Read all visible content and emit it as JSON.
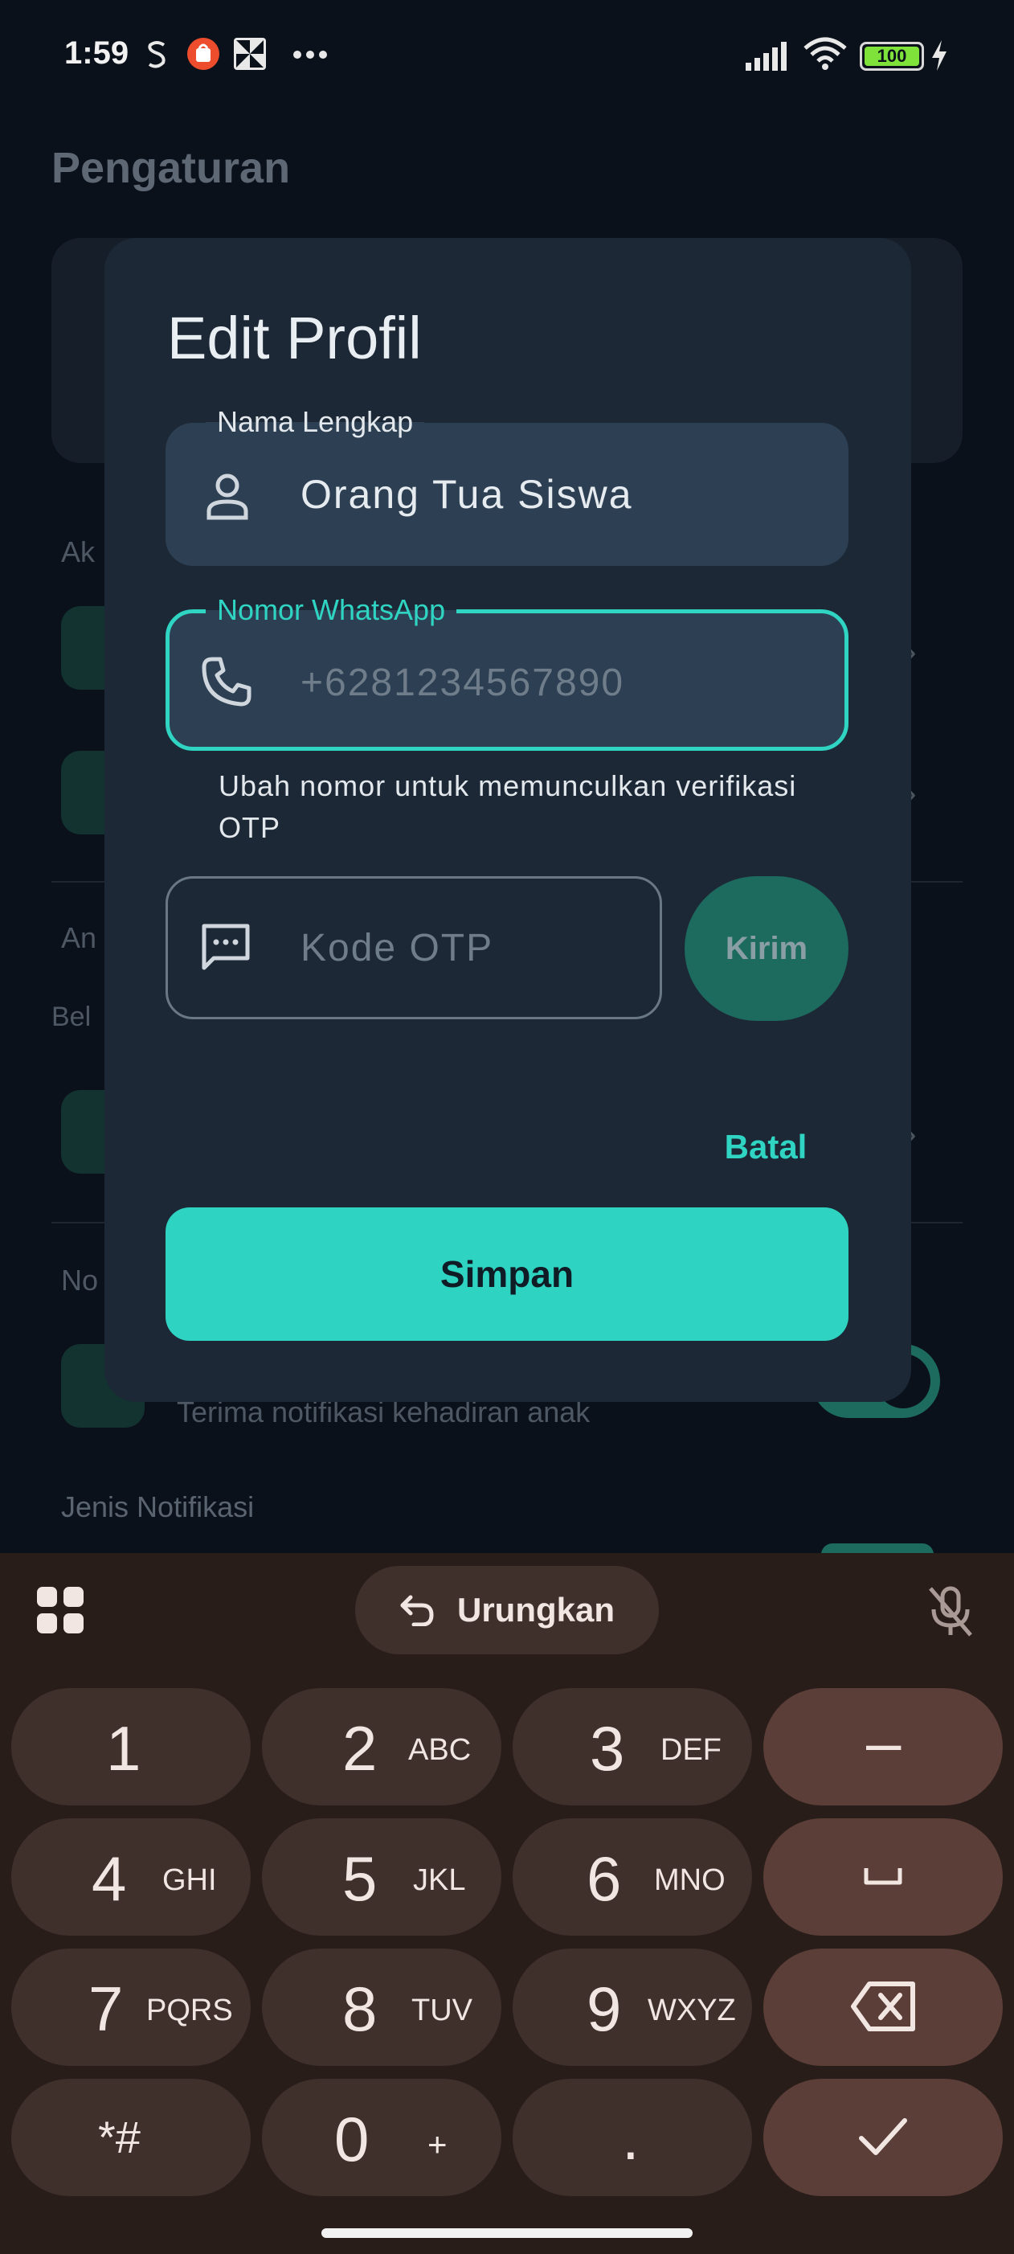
{
  "status_bar": {
    "time": "1:59",
    "notif_icons": [
      "s-shaped-icon",
      "shopee-icon",
      "pinwheel-icon",
      "more-dots-icon"
    ],
    "battery": "100",
    "signal_icon": "signal-bars-icon",
    "wifi_icon": "wifi-icon",
    "charging_icon": "bolt-icon"
  },
  "background_page": {
    "title": "Pengaturan",
    "section_labels": [
      "Ak",
      "An",
      "Bel",
      "No"
    ],
    "notification_subtitle": "Terima notifikasi kehadiran anak",
    "notification_types_label": "Jenis Notifikasi"
  },
  "dialog": {
    "title": "Edit Profil",
    "name_field": {
      "label": "Nama Lengkap",
      "value": "Orang Tua Siswa",
      "icon": "person-icon"
    },
    "phone_field": {
      "label": "Nomor WhatsApp",
      "placeholder": "+6281234567890",
      "icon": "phone-icon",
      "helper": "Ubah nomor untuk memunculkan verifikasi OTP"
    },
    "otp_field": {
      "placeholder": "Kode OTP",
      "icon": "message-icon"
    },
    "send_button": "Kirim",
    "cancel_button": "Batal",
    "save_button": "Simpan"
  },
  "keyboard": {
    "undo_label": "Urungkan",
    "keys": [
      {
        "digit": "1",
        "letters": ""
      },
      {
        "digit": "2",
        "letters": "ABC"
      },
      {
        "digit": "3",
        "letters": "DEF"
      },
      {
        "digit": "4",
        "letters": "GHI"
      },
      {
        "digit": "5",
        "letters": "JKL"
      },
      {
        "digit": "6",
        "letters": "MNO"
      },
      {
        "digit": "7",
        "letters": "PQRS"
      },
      {
        "digit": "8",
        "letters": "TUV"
      },
      {
        "digit": "9",
        "letters": "WXYZ"
      },
      {
        "digit": "*#",
        "letters": ""
      },
      {
        "digit": "0",
        "letters": "+"
      },
      {
        "digit": ".",
        "letters": ""
      }
    ],
    "function_keys": [
      "–",
      "space-icon",
      "backspace-icon",
      "check-icon"
    ]
  },
  "colors": {
    "accent": "#2fd5c2",
    "dialog_bg": "#1c2836",
    "field_bg": "#2d3f52",
    "keyboard_bg": "#291d1a"
  }
}
